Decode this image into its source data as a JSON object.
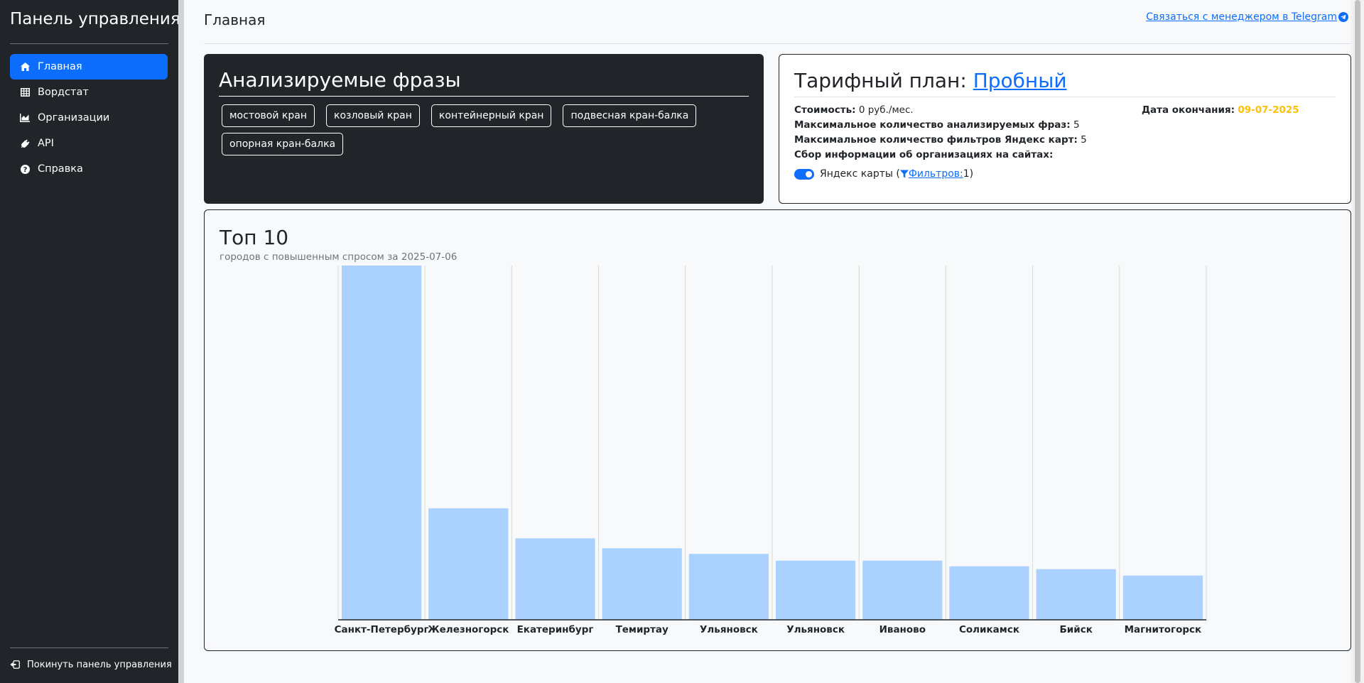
{
  "sidebar": {
    "title": "Панель управления",
    "items": [
      {
        "label": "Главная",
        "icon": "home-icon",
        "active": true
      },
      {
        "label": "Вордстат",
        "icon": "table-icon",
        "active": false
      },
      {
        "label": "Организации",
        "icon": "chart-icon",
        "active": false
      },
      {
        "label": "API",
        "icon": "plug-icon",
        "active": false
      },
      {
        "label": "Справка",
        "icon": "question-icon",
        "active": false
      }
    ],
    "logout_label": "Покинуть панель управления"
  },
  "header": {
    "title": "Главная",
    "telegram_link": "Связаться с менеджером в Telegram"
  },
  "phrases": {
    "title": "Анализируемые фразы",
    "items": [
      "мостовой кран",
      "козловый кран",
      "контейнерный кран",
      "подвесная кран-балка",
      "опорная кран-балка"
    ]
  },
  "plan": {
    "title_prefix": "Тарифный план:",
    "name": "Пробный",
    "cost_label": "Стоимость:",
    "cost_value": "0 руб./мес.",
    "max_phrases_label": "Максимальное количество анализируемых фраз:",
    "max_phrases_value": "5",
    "max_filters_label": "Максимальное количество фильтров Яндекс карт:",
    "max_filters_value": "5",
    "collect_label": "Сбор информации об организациях на сайтах:",
    "end_label": "Дата окончания:",
    "end_value": "09-07-2025",
    "end_color": "#ffc107",
    "source_label": "Яндекс карты (",
    "filters_link": "Фильтров:",
    "filters_count": " 1)",
    "source_enabled": true
  },
  "top": {
    "title": "Топ 10",
    "subtitle": "городов с повышенным спросом за 2025-07-06"
  },
  "chart_data": {
    "type": "bar",
    "categories": [
      "Санкт-Петербург",
      "Железногорск",
      "Екатеринбург",
      "Темиртау",
      "Ульяновск",
      "Ульяновск",
      "Иваново",
      "Соликамск",
      "Бийск",
      "Магнитогорск"
    ],
    "values": [
      100,
      31.5,
      23,
      20.2,
      18.6,
      16.7,
      16.7,
      15.1,
      14.3,
      12.5
    ],
    "ylim": [
      0,
      100
    ],
    "grid": true,
    "bar_color": "#abd1ff"
  },
  "colors": {
    "primary": "#0d6efd",
    "dark": "#212529",
    "warning": "#ffc107"
  }
}
